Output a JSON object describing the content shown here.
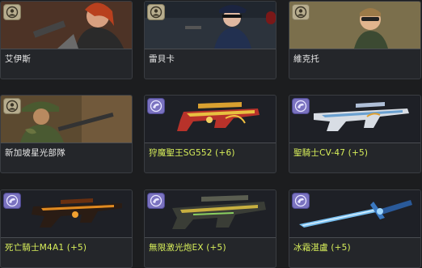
{
  "items": [
    {
      "name": "艾伊斯",
      "type": "character"
    },
    {
      "name": "雷貝卡",
      "type": "character"
    },
    {
      "name": "維克托",
      "type": "character"
    },
    {
      "name": "新加坡星光部隊",
      "type": "character"
    },
    {
      "name": "狩魔聖王SG552 (+6)",
      "type": "weapon"
    },
    {
      "name": "聖騎士CV-47 (+5)",
      "type": "weapon"
    },
    {
      "name": "死亡騎士M4A1 (+5)",
      "type": "weapon"
    },
    {
      "name": "無限激光炮EX (+5)",
      "type": "weapon"
    },
    {
      "name": "冰霜湛盧 (+5)",
      "type": "weapon"
    }
  ],
  "icons": {
    "character": "person-badge-icon",
    "weapon": "weapon-badge-icon"
  },
  "colors": {
    "character_label": "#e8e8e8",
    "weapon_label": "#d8ef5a",
    "weapon_badge": "#7a72c0",
    "character_badge": "#b7ad8e"
  }
}
